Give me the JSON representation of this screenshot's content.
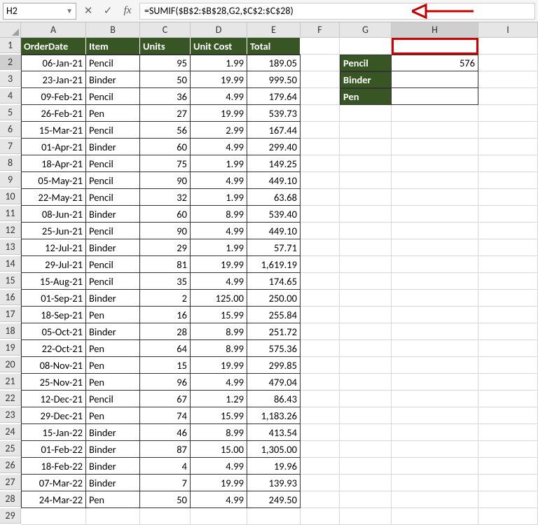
{
  "name_box": "H2",
  "formula": "=SUMIF($B$2:$B$28,G2,$C$2:$C$28)",
  "columns": [
    "A",
    "B",
    "C",
    "D",
    "E",
    "F",
    "G",
    "H",
    "I"
  ],
  "headers": {
    "A": "OrderDate",
    "B": "Item",
    "C": "Units",
    "D": "Unit Cost",
    "E": "Total"
  },
  "rows": [
    {
      "A": "06-Jan-21",
      "B": "Pencil",
      "C": "95",
      "D": "1.99",
      "E": "189.05"
    },
    {
      "A": "23-Jan-21",
      "B": "Binder",
      "C": "50",
      "D": "19.99",
      "E": "999.50"
    },
    {
      "A": "09-Feb-21",
      "B": "Pencil",
      "C": "36",
      "D": "4.99",
      "E": "179.64"
    },
    {
      "A": "26-Feb-21",
      "B": "Pen",
      "C": "27",
      "D": "19.99",
      "E": "539.73"
    },
    {
      "A": "15-Mar-21",
      "B": "Pencil",
      "C": "56",
      "D": "2.99",
      "E": "167.44"
    },
    {
      "A": "01-Apr-21",
      "B": "Binder",
      "C": "60",
      "D": "4.99",
      "E": "299.40"
    },
    {
      "A": "18-Apr-21",
      "B": "Pencil",
      "C": "75",
      "D": "1.99",
      "E": "149.25"
    },
    {
      "A": "05-May-21",
      "B": "Pencil",
      "C": "90",
      "D": "4.99",
      "E": "449.10"
    },
    {
      "A": "22-May-21",
      "B": "Pencil",
      "C": "32",
      "D": "1.99",
      "E": "63.68"
    },
    {
      "A": "08-Jun-21",
      "B": "Binder",
      "C": "60",
      "D": "8.99",
      "E": "539.40"
    },
    {
      "A": "25-Jun-21",
      "B": "Pencil",
      "C": "90",
      "D": "4.99",
      "E": "449.10"
    },
    {
      "A": "12-Jul-21",
      "B": "Binder",
      "C": "29",
      "D": "1.99",
      "E": "57.71"
    },
    {
      "A": "29-Jul-21",
      "B": "Pencil",
      "C": "81",
      "D": "19.99",
      "E": "1,619.19"
    },
    {
      "A": "15-Aug-21",
      "B": "Pencil",
      "C": "35",
      "D": "4.99",
      "E": "174.65"
    },
    {
      "A": "01-Sep-21",
      "B": "Binder",
      "C": "2",
      "D": "125.00",
      "E": "250.00"
    },
    {
      "A": "18-Sep-21",
      "B": "Pen",
      "C": "16",
      "D": "15.99",
      "E": "255.84"
    },
    {
      "A": "05-Oct-21",
      "B": "Binder",
      "C": "28",
      "D": "8.99",
      "E": "251.72"
    },
    {
      "A": "22-Oct-21",
      "B": "Pen",
      "C": "64",
      "D": "8.99",
      "E": "575.36"
    },
    {
      "A": "08-Nov-21",
      "B": "Pen",
      "C": "15",
      "D": "19.99",
      "E": "299.85"
    },
    {
      "A": "25-Nov-21",
      "B": "Pen",
      "C": "96",
      "D": "4.99",
      "E": "479.04"
    },
    {
      "A": "12-Dec-21",
      "B": "Pencil",
      "C": "67",
      "D": "1.29",
      "E": "86.43"
    },
    {
      "A": "29-Dec-21",
      "B": "Pen",
      "C": "74",
      "D": "15.99",
      "E": "1,183.26"
    },
    {
      "A": "15-Jan-22",
      "B": "Binder",
      "C": "46",
      "D": "8.99",
      "E": "413.54"
    },
    {
      "A": "01-Feb-22",
      "B": "Binder",
      "C": "87",
      "D": "15.00",
      "E": "1,305.00"
    },
    {
      "A": "18-Feb-22",
      "B": "Binder",
      "C": "4",
      "D": "4.99",
      "E": "19.96"
    },
    {
      "A": "07-Mar-22",
      "B": "Binder",
      "C": "7",
      "D": "19.99",
      "E": "139.93"
    },
    {
      "A": "24-Mar-22",
      "B": "Pen",
      "C": "50",
      "D": "4.99",
      "E": "249.50"
    }
  ],
  "summary": [
    {
      "label": "Pencil",
      "value": "576"
    },
    {
      "label": "Binder",
      "value": ""
    },
    {
      "label": "Pen",
      "value": ""
    }
  ]
}
